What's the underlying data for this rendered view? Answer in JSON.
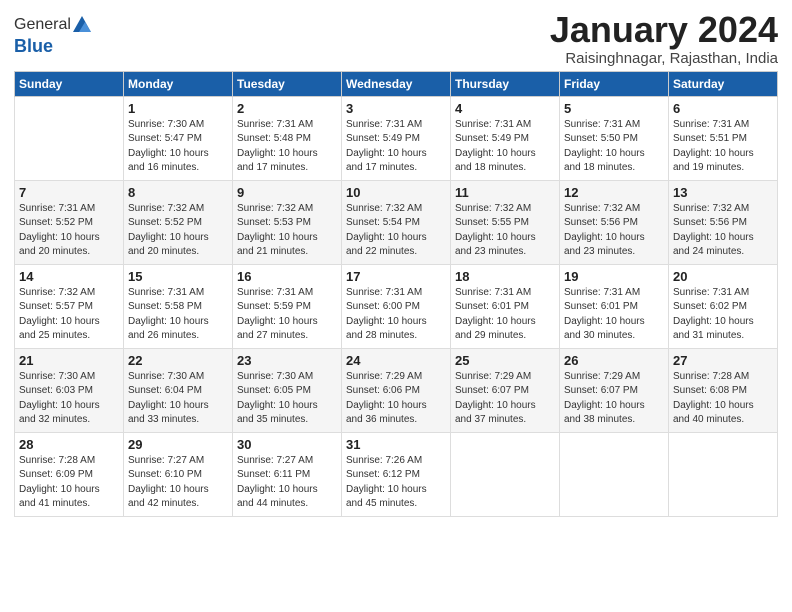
{
  "header": {
    "logo_general": "General",
    "logo_blue": "Blue",
    "month_title": "January 2024",
    "location": "Raisinghnagar, Rajasthan, India"
  },
  "weekdays": [
    "Sunday",
    "Monday",
    "Tuesday",
    "Wednesday",
    "Thursday",
    "Friday",
    "Saturday"
  ],
  "weeks": [
    [
      {
        "day": "",
        "sunrise": "",
        "sunset": "",
        "daylight": ""
      },
      {
        "day": "1",
        "sunrise": "Sunrise: 7:30 AM",
        "sunset": "Sunset: 5:47 PM",
        "daylight": "Daylight: 10 hours and 16 minutes."
      },
      {
        "day": "2",
        "sunrise": "Sunrise: 7:31 AM",
        "sunset": "Sunset: 5:48 PM",
        "daylight": "Daylight: 10 hours and 17 minutes."
      },
      {
        "day": "3",
        "sunrise": "Sunrise: 7:31 AM",
        "sunset": "Sunset: 5:49 PM",
        "daylight": "Daylight: 10 hours and 17 minutes."
      },
      {
        "day": "4",
        "sunrise": "Sunrise: 7:31 AM",
        "sunset": "Sunset: 5:49 PM",
        "daylight": "Daylight: 10 hours and 18 minutes."
      },
      {
        "day": "5",
        "sunrise": "Sunrise: 7:31 AM",
        "sunset": "Sunset: 5:50 PM",
        "daylight": "Daylight: 10 hours and 18 minutes."
      },
      {
        "day": "6",
        "sunrise": "Sunrise: 7:31 AM",
        "sunset": "Sunset: 5:51 PM",
        "daylight": "Daylight: 10 hours and 19 minutes."
      }
    ],
    [
      {
        "day": "7",
        "sunrise": "Sunrise: 7:31 AM",
        "sunset": "Sunset: 5:52 PM",
        "daylight": "Daylight: 10 hours and 20 minutes."
      },
      {
        "day": "8",
        "sunrise": "Sunrise: 7:32 AM",
        "sunset": "Sunset: 5:52 PM",
        "daylight": "Daylight: 10 hours and 20 minutes."
      },
      {
        "day": "9",
        "sunrise": "Sunrise: 7:32 AM",
        "sunset": "Sunset: 5:53 PM",
        "daylight": "Daylight: 10 hours and 21 minutes."
      },
      {
        "day": "10",
        "sunrise": "Sunrise: 7:32 AM",
        "sunset": "Sunset: 5:54 PM",
        "daylight": "Daylight: 10 hours and 22 minutes."
      },
      {
        "day": "11",
        "sunrise": "Sunrise: 7:32 AM",
        "sunset": "Sunset: 5:55 PM",
        "daylight": "Daylight: 10 hours and 23 minutes."
      },
      {
        "day": "12",
        "sunrise": "Sunrise: 7:32 AM",
        "sunset": "Sunset: 5:56 PM",
        "daylight": "Daylight: 10 hours and 23 minutes."
      },
      {
        "day": "13",
        "sunrise": "Sunrise: 7:32 AM",
        "sunset": "Sunset: 5:56 PM",
        "daylight": "Daylight: 10 hours and 24 minutes."
      }
    ],
    [
      {
        "day": "14",
        "sunrise": "Sunrise: 7:32 AM",
        "sunset": "Sunset: 5:57 PM",
        "daylight": "Daylight: 10 hours and 25 minutes."
      },
      {
        "day": "15",
        "sunrise": "Sunrise: 7:31 AM",
        "sunset": "Sunset: 5:58 PM",
        "daylight": "Daylight: 10 hours and 26 minutes."
      },
      {
        "day": "16",
        "sunrise": "Sunrise: 7:31 AM",
        "sunset": "Sunset: 5:59 PM",
        "daylight": "Daylight: 10 hours and 27 minutes."
      },
      {
        "day": "17",
        "sunrise": "Sunrise: 7:31 AM",
        "sunset": "Sunset: 6:00 PM",
        "daylight": "Daylight: 10 hours and 28 minutes."
      },
      {
        "day": "18",
        "sunrise": "Sunrise: 7:31 AM",
        "sunset": "Sunset: 6:01 PM",
        "daylight": "Daylight: 10 hours and 29 minutes."
      },
      {
        "day": "19",
        "sunrise": "Sunrise: 7:31 AM",
        "sunset": "Sunset: 6:01 PM",
        "daylight": "Daylight: 10 hours and 30 minutes."
      },
      {
        "day": "20",
        "sunrise": "Sunrise: 7:31 AM",
        "sunset": "Sunset: 6:02 PM",
        "daylight": "Daylight: 10 hours and 31 minutes."
      }
    ],
    [
      {
        "day": "21",
        "sunrise": "Sunrise: 7:30 AM",
        "sunset": "Sunset: 6:03 PM",
        "daylight": "Daylight: 10 hours and 32 minutes."
      },
      {
        "day": "22",
        "sunrise": "Sunrise: 7:30 AM",
        "sunset": "Sunset: 6:04 PM",
        "daylight": "Daylight: 10 hours and 33 minutes."
      },
      {
        "day": "23",
        "sunrise": "Sunrise: 7:30 AM",
        "sunset": "Sunset: 6:05 PM",
        "daylight": "Daylight: 10 hours and 35 minutes."
      },
      {
        "day": "24",
        "sunrise": "Sunrise: 7:29 AM",
        "sunset": "Sunset: 6:06 PM",
        "daylight": "Daylight: 10 hours and 36 minutes."
      },
      {
        "day": "25",
        "sunrise": "Sunrise: 7:29 AM",
        "sunset": "Sunset: 6:07 PM",
        "daylight": "Daylight: 10 hours and 37 minutes."
      },
      {
        "day": "26",
        "sunrise": "Sunrise: 7:29 AM",
        "sunset": "Sunset: 6:07 PM",
        "daylight": "Daylight: 10 hours and 38 minutes."
      },
      {
        "day": "27",
        "sunrise": "Sunrise: 7:28 AM",
        "sunset": "Sunset: 6:08 PM",
        "daylight": "Daylight: 10 hours and 40 minutes."
      }
    ],
    [
      {
        "day": "28",
        "sunrise": "Sunrise: 7:28 AM",
        "sunset": "Sunset: 6:09 PM",
        "daylight": "Daylight: 10 hours and 41 minutes."
      },
      {
        "day": "29",
        "sunrise": "Sunrise: 7:27 AM",
        "sunset": "Sunset: 6:10 PM",
        "daylight": "Daylight: 10 hours and 42 minutes."
      },
      {
        "day": "30",
        "sunrise": "Sunrise: 7:27 AM",
        "sunset": "Sunset: 6:11 PM",
        "daylight": "Daylight: 10 hours and 44 minutes."
      },
      {
        "day": "31",
        "sunrise": "Sunrise: 7:26 AM",
        "sunset": "Sunset: 6:12 PM",
        "daylight": "Daylight: 10 hours and 45 minutes."
      },
      {
        "day": "",
        "sunrise": "",
        "sunset": "",
        "daylight": ""
      },
      {
        "day": "",
        "sunrise": "",
        "sunset": "",
        "daylight": ""
      },
      {
        "day": "",
        "sunrise": "",
        "sunset": "",
        "daylight": ""
      }
    ]
  ]
}
